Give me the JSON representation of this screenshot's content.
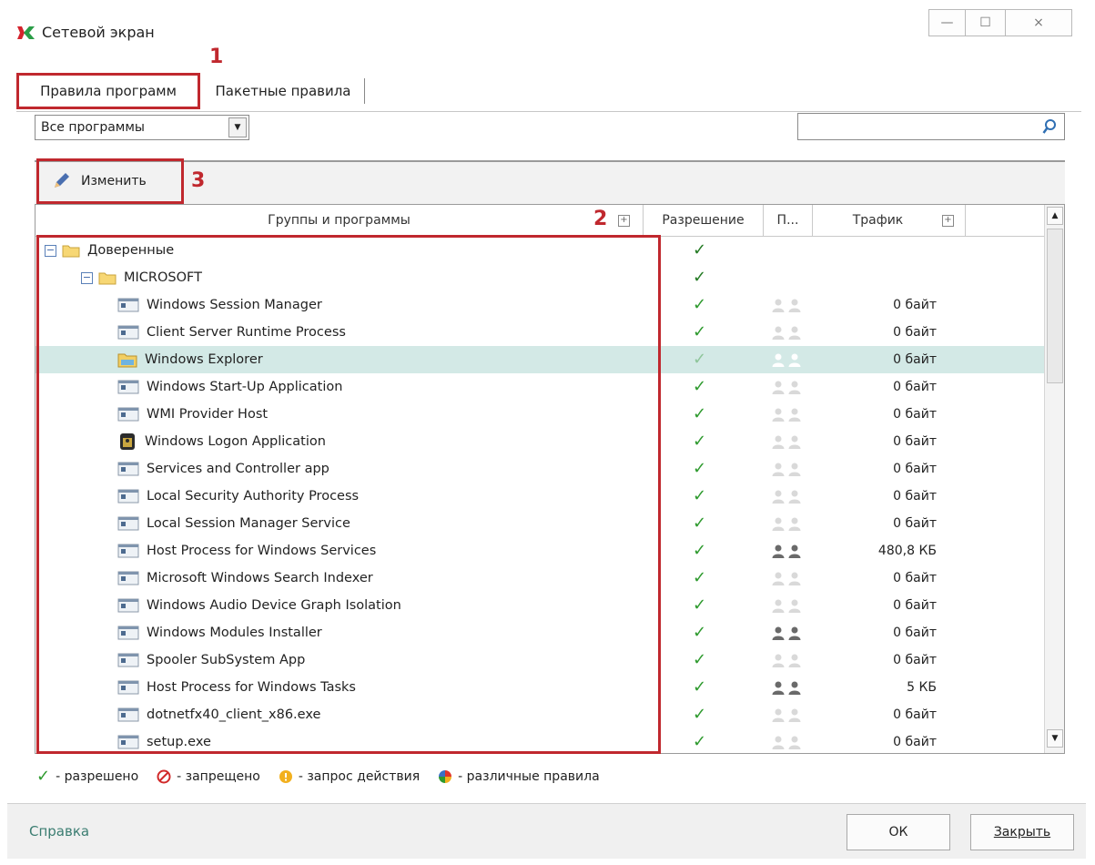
{
  "window": {
    "title": "Сетевой экран",
    "minimize": "—",
    "maximize": "☐",
    "close": "×"
  },
  "annotations": {
    "a1": "1",
    "a2": "2",
    "a3": "3"
  },
  "tabs": [
    {
      "label": "Правила программ",
      "active": true
    },
    {
      "label": "Пакетные правила",
      "active": false
    }
  ],
  "filter": {
    "selected": "Все программы"
  },
  "search": {
    "value": "",
    "placeholder": ""
  },
  "toolbar": {
    "edit_label": "Изменить"
  },
  "grid": {
    "columns": [
      "Группы и программы",
      "Разрешение",
      "П...",
      "Трафик"
    ],
    "rows": [
      {
        "level": 0,
        "type": "group",
        "name": "Доверенные",
        "permission": "allow",
        "users": "",
        "traffic": ""
      },
      {
        "level": 1,
        "type": "group",
        "name": "MICROSOFT",
        "permission": "allow",
        "users": "",
        "traffic": ""
      },
      {
        "level": 2,
        "type": "app",
        "name": "Windows Session Manager",
        "permission": "allow",
        "users": "inactive",
        "traffic": "0 байт"
      },
      {
        "level": 2,
        "type": "app",
        "name": "Client Server Runtime Process",
        "permission": "allow",
        "users": "inactive",
        "traffic": "0 байт"
      },
      {
        "level": 2,
        "type": "explorer",
        "name": "Windows Explorer",
        "permission": "allow",
        "users": "inactive",
        "traffic": "0 байт",
        "selected": true
      },
      {
        "level": 2,
        "type": "app",
        "name": "Windows Start-Up Application",
        "permission": "allow",
        "users": "inactive",
        "traffic": "0 байт"
      },
      {
        "level": 2,
        "type": "app",
        "name": "WMI Provider Host",
        "permission": "allow",
        "users": "inactive",
        "traffic": "0 байт"
      },
      {
        "level": 2,
        "type": "logon",
        "name": "Windows Logon Application",
        "permission": "allow",
        "users": "inactive",
        "traffic": "0 байт"
      },
      {
        "level": 2,
        "type": "app",
        "name": "Services and Controller app",
        "permission": "allow",
        "users": "inactive",
        "traffic": "0 байт"
      },
      {
        "level": 2,
        "type": "app",
        "name": "Local Security Authority Process",
        "permission": "allow",
        "users": "inactive",
        "traffic": "0 байт"
      },
      {
        "level": 2,
        "type": "app",
        "name": "Local Session Manager Service",
        "permission": "allow",
        "users": "inactive",
        "traffic": "0 байт"
      },
      {
        "level": 2,
        "type": "app",
        "name": "Host Process for Windows Services",
        "permission": "allow",
        "users": "active",
        "traffic": "480,8 КБ"
      },
      {
        "level": 2,
        "type": "app",
        "name": "Microsoft Windows Search Indexer",
        "permission": "allow",
        "users": "inactive",
        "traffic": "0 байт"
      },
      {
        "level": 2,
        "type": "app",
        "name": "Windows Audio Device Graph Isolation",
        "permission": "allow",
        "users": "inactive",
        "traffic": "0 байт"
      },
      {
        "level": 2,
        "type": "app",
        "name": "Windows Modules Installer",
        "permission": "allow",
        "users": "active",
        "traffic": "0 байт"
      },
      {
        "level": 2,
        "type": "app",
        "name": "Spooler SubSystem App",
        "permission": "allow",
        "users": "inactive",
        "traffic": "0 байт"
      },
      {
        "level": 2,
        "type": "app",
        "name": "Host Process for Windows Tasks",
        "permission": "allow",
        "users": "active",
        "traffic": "5 КБ"
      },
      {
        "level": 2,
        "type": "app",
        "name": "dotnetfx40_client_x86.exe",
        "permission": "allow",
        "users": "inactive",
        "traffic": "0 байт"
      },
      {
        "level": 2,
        "type": "app",
        "name": "setup.exe",
        "permission": "allow",
        "users": "inactive",
        "traffic": "0 байт"
      }
    ]
  },
  "legend": [
    {
      "icon": "check-icon",
      "text": "- разрешено"
    },
    {
      "icon": "forbidden-icon",
      "text": "- запрещено"
    },
    {
      "icon": "question-icon",
      "text": "- запрос действия"
    },
    {
      "icon": "mixed-rules-icon",
      "text": "- различные правила"
    }
  ],
  "footer": {
    "help": "Справка",
    "ok": "ОК",
    "close": "Закрыть"
  },
  "colors": {
    "highlight": "#c0282e",
    "check": "#2e9a2e",
    "selected_row": "#d3e9e6",
    "help_link": "#3b7d71"
  }
}
